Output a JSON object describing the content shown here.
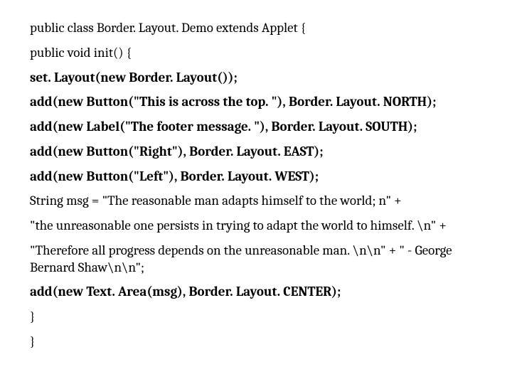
{
  "lines": [
    {
      "text": "public class Border. Layout. Demo extends Applet {",
      "bold": false
    },
    {
      "text": "public void init() {",
      "bold": false
    },
    {
      "text": "set. Layout(new Border. Layout());",
      "bold": true
    },
    {
      "text": "add(new Button(\"This is across the top. \"), Border. Layout. NORTH);",
      "bold": true
    },
    {
      "text": "add(new Label(\"The footer message. \"), Border. Layout. SOUTH);",
      "bold": true
    },
    {
      "text": "add(new Button(\"Right\"), Border. Layout. EAST);",
      "bold": true
    },
    {
      "text": "add(new Button(\"Left\"), Border. Layout. WEST);",
      "bold": true
    },
    {
      "text": "String msg = \"The reasonable man adapts himself to the world; n\" +",
      "bold": false
    },
    {
      "text": "\"the unreasonable one persists in trying to adapt the world to himself. \\n\" +",
      "bold": false
    },
    {
      "text": "\"Therefore all progress depends on the unreasonable man. \\n\\n\" + \" - George Bernard Shaw\\n\\n\";",
      "bold": false
    },
    {
      "text": "add(new Text. Area(msg), Border. Layout. CENTER);",
      "bold": true
    },
    {
      "text": "}",
      "bold": false
    },
    {
      "text": "}",
      "bold": false
    }
  ]
}
